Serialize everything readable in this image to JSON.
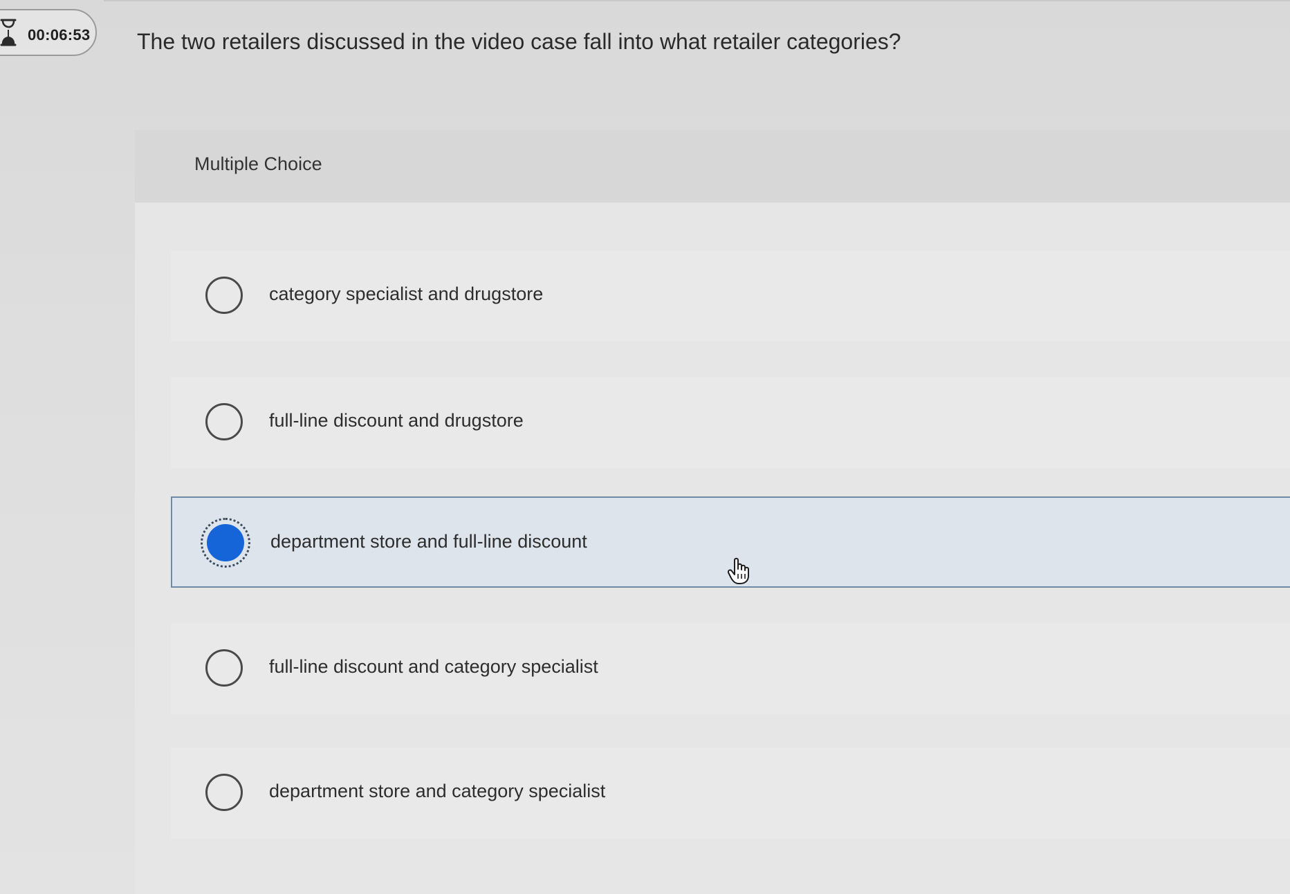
{
  "timer": {
    "icon": "hourglass-icon",
    "time": "00:06:53"
  },
  "question": {
    "text": "The two retailers discussed in the video case fall into what retailer categories?"
  },
  "card": {
    "type_label": "Multiple Choice"
  },
  "options": [
    {
      "label": "category specialist and drugstore",
      "selected": false
    },
    {
      "label": "full-line discount and drugstore",
      "selected": false
    },
    {
      "label": "department store and full-line discount",
      "selected": true
    },
    {
      "label": "full-line discount and category specialist",
      "selected": false
    },
    {
      "label": "department store and category specialist",
      "selected": false
    }
  ],
  "colors": {
    "selected_radio": "#1565d8",
    "selected_border": "#6f88a6",
    "selected_background": "#dde4ec"
  }
}
